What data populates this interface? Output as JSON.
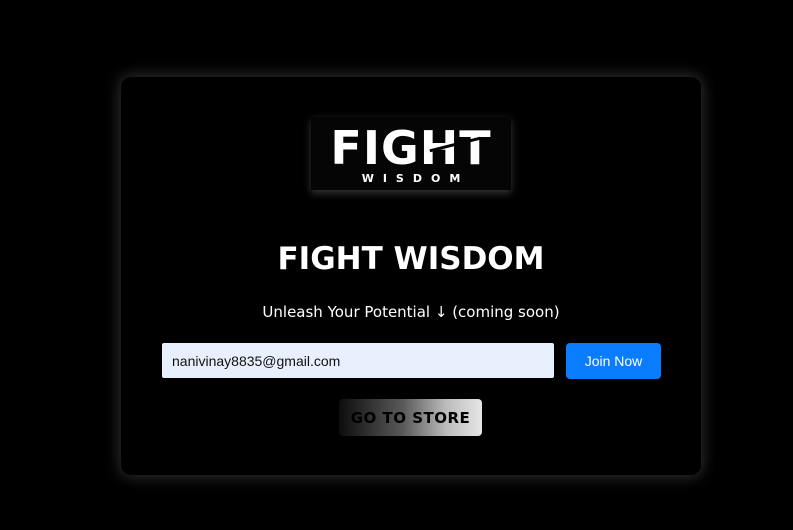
{
  "logo": {
    "main_text": "FIGHT",
    "sub_text": "WISDOM"
  },
  "header": {
    "title": "FIGHT WISDOM",
    "tagline": "Unleash Your Potential ↓ (coming soon)"
  },
  "signup": {
    "email_value": "nanivinay8835@gmail.com",
    "join_label": "Join Now"
  },
  "store": {
    "label": "GO TO STORE"
  },
  "colors": {
    "background": "#000000",
    "input_background": "#e8f0fe",
    "join_button": "#0a7cff",
    "text": "#ffffff"
  }
}
